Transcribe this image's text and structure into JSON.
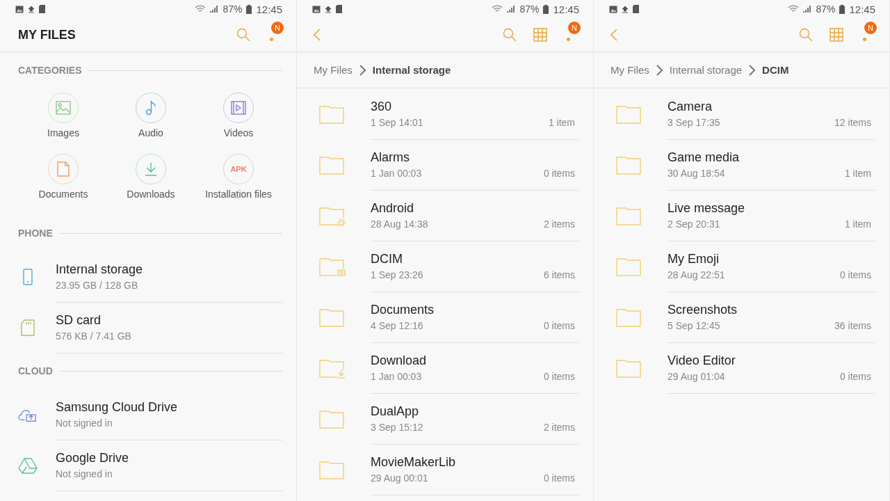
{
  "panels": [
    {
      "kind": "home",
      "status": {
        "battery": "87%",
        "time": "12:45"
      },
      "title": "MY FILES",
      "notification_badge": "N",
      "sections": [
        {
          "kind": "categories",
          "label": "CATEGORIES",
          "items": [
            {
              "kind": "images",
              "label": "Images",
              "color": "#8cc98a"
            },
            {
              "kind": "audio",
              "label": "Audio",
              "color": "#4a9fd6"
            },
            {
              "kind": "videos",
              "label": "Videos",
              "color": "#8f7ad6"
            },
            {
              "kind": "documents",
              "label": "Documents",
              "color": "#ef9a6a"
            },
            {
              "kind": "downloads",
              "label": "Downloads",
              "color": "#5bb8a8"
            },
            {
              "kind": "apk",
              "label": "Installation files",
              "icon_text": "APK",
              "color": "#ee7d6e"
            }
          ]
        },
        {
          "kind": "storage",
          "label": "PHONE",
          "items": [
            {
              "kind": "phone",
              "name": "Internal storage",
              "detail": "23.95 GB / 128 GB"
            },
            {
              "kind": "sdcard",
              "name": "SD card",
              "detail": "576 KB / 7.41 GB"
            }
          ]
        },
        {
          "kind": "storage",
          "label": "CLOUD",
          "items": [
            {
              "kind": "cloud",
              "name": "Samsung Cloud Drive",
              "detail": "Not signed in"
            },
            {
              "kind": "drive",
              "name": "Google Drive",
              "detail": "Not signed in"
            }
          ]
        }
      ]
    },
    {
      "kind": "folder",
      "status": {
        "battery": "87%",
        "time": "12:45"
      },
      "notification_badge": "N",
      "breadcrumb": [
        {
          "label": "My Files",
          "current": false
        },
        {
          "label": "Internal storage",
          "current": true
        }
      ],
      "folders": [
        {
          "kind": "plain",
          "name": "360",
          "date": "1 Sep 14:01",
          "count": "1 item"
        },
        {
          "kind": "plain",
          "name": "Alarms",
          "date": "1 Jan 00:03",
          "count": "0 items"
        },
        {
          "kind": "settings",
          "name": "Android",
          "date": "28 Aug 14:38",
          "count": "2 items"
        },
        {
          "kind": "camera",
          "name": "DCIM",
          "date": "1 Sep 23:26",
          "count": "6 items"
        },
        {
          "kind": "plain",
          "name": "Documents",
          "date": "4 Sep 12:16",
          "count": "0 items"
        },
        {
          "kind": "download",
          "name": "Download",
          "date": "1 Jan 00:03",
          "count": "0 items"
        },
        {
          "kind": "plain",
          "name": "DualApp",
          "date": "3 Sep 15:12",
          "count": "2 items"
        },
        {
          "kind": "plain",
          "name": "MovieMakerLib",
          "date": "29 Aug 00:01",
          "count": "0 items"
        }
      ]
    },
    {
      "kind": "folder",
      "status": {
        "battery": "87%",
        "time": "12:45"
      },
      "notification_badge": "N",
      "breadcrumb": [
        {
          "label": "My Files",
          "current": false
        },
        {
          "label": "Internal storage",
          "current": false
        },
        {
          "label": "DCIM",
          "current": true
        }
      ],
      "folders": [
        {
          "kind": "plain",
          "name": "Camera",
          "date": "3 Sep 17:35",
          "count": "12 items"
        },
        {
          "kind": "plain",
          "name": "Game media",
          "date": "30 Aug 18:54",
          "count": "1 item"
        },
        {
          "kind": "plain",
          "name": "Live message",
          "date": "2 Sep 20:31",
          "count": "1 item"
        },
        {
          "kind": "plain",
          "name": "My Emoji",
          "date": "28 Aug 22:51",
          "count": "0 items"
        },
        {
          "kind": "plain",
          "name": "Screenshots",
          "date": "5 Sep 12:45",
          "count": "36 items"
        },
        {
          "kind": "plain",
          "name": "Video Editor",
          "date": "29 Aug 01:04",
          "count": "0 items"
        }
      ]
    }
  ]
}
